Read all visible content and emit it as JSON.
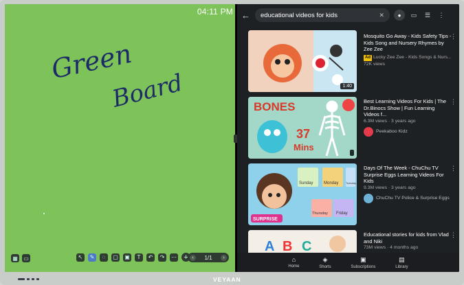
{
  "board": {
    "clock": "04:11 PM",
    "handwriting": [
      "Green",
      "Board"
    ],
    "page_indicator": "1/1"
  },
  "youtube": {
    "search_query": "educational videos for kids",
    "videos": [
      {
        "title": "Mosquito Go Away - Kids Safety Tips - Kids Song and Nursery Rhymes by Zee Zee",
        "ad_label": "Ad",
        "channel": "Lucky Zee Zee - Kids Songs & Nurs...",
        "meta": "72K views",
        "duration": "1:40"
      },
      {
        "title": "Best Learning Videos For Kids | The Dr.Binocs Show | Fun Learning Videos f...",
        "meta": "6.3M views · 3 years ago",
        "channel": "Peekaboo Kidz",
        "thumb_text_1": "BONES",
        "thumb_text_2": "37",
        "thumb_text_3": "Mins"
      },
      {
        "title": "Days Of The Week - ChuChu TV Surprise Eggs Learning Videos For Kids",
        "meta": "9.3M views · 3 years ago",
        "channel": "ChuChu TV Police & Surprise Eggs",
        "thumb_text_1": "Sunday",
        "thumb_text_2": "Monday",
        "thumb_text_3": "Tuesday",
        "thumb_text_4": "Thursday",
        "thumb_text_5": "Friday",
        "thumb_text_6": "SURPRISE"
      },
      {
        "title": "Educational stories for kids from Vlad and Niki",
        "meta": "73M views · 4 months ago",
        "thumb_text_1": "A",
        "thumb_text_2": "B",
        "thumb_text_3": "C"
      }
    ],
    "nav": [
      {
        "label": "Home",
        "icon": "home-icon"
      },
      {
        "label": "Shorts",
        "icon": "shorts-icon"
      },
      {
        "label": "Subscriptions",
        "icon": "subscriptions-icon"
      },
      {
        "label": "Library",
        "icon": "library-icon"
      }
    ]
  },
  "device": {
    "brand": "VEYAAN"
  },
  "colors": {
    "board_green": "#7ec35a",
    "yt_bg": "#1e2124",
    "ad_yellow": "#f2c200"
  }
}
